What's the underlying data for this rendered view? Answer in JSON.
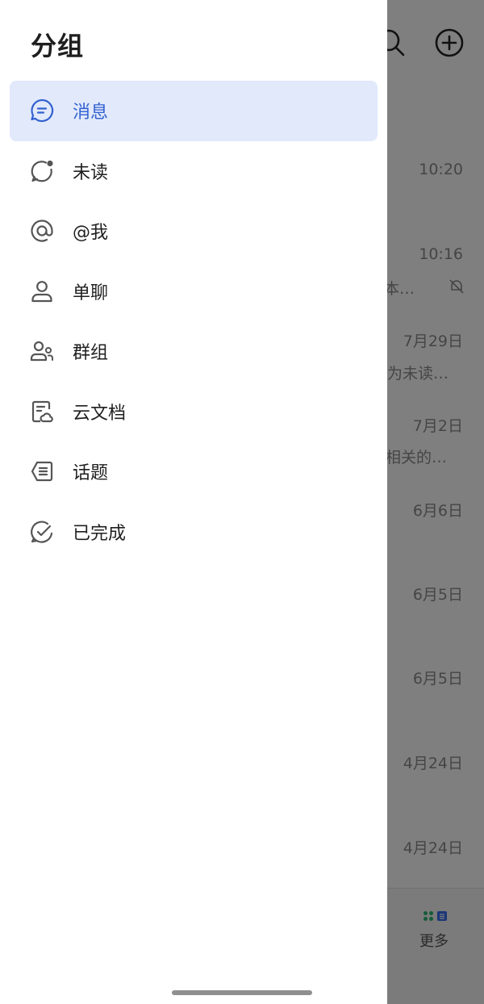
{
  "drawer": {
    "title": "分组",
    "items": [
      {
        "label": "消息",
        "icon": "message-icon",
        "active": true
      },
      {
        "label": "未读",
        "icon": "unread-icon",
        "active": false
      },
      {
        "label": "@我",
        "icon": "at-icon",
        "active": false
      },
      {
        "label": "单聊",
        "icon": "person-icon",
        "active": false
      },
      {
        "label": "群组",
        "icon": "group-icon",
        "active": false
      },
      {
        "label": "云文档",
        "icon": "cloud-doc-icon",
        "active": false
      },
      {
        "label": "话题",
        "icon": "topic-icon",
        "active": false
      },
      {
        "label": "已完成",
        "icon": "done-icon",
        "active": false
      }
    ]
  },
  "background": {
    "times": [
      "10:20",
      "10:16",
      "7月29日",
      "7月2日",
      "6月6日",
      "6月5日",
      "6月5日",
      "4月24日",
      "4月24日"
    ],
    "snippets": [
      "本…",
      "为未读…",
      "相关的…"
    ],
    "bottom_more_label": "更多"
  },
  "colors": {
    "accent": "#3261d0",
    "active_bg": "#e1e9fb",
    "icon": "#555555"
  }
}
